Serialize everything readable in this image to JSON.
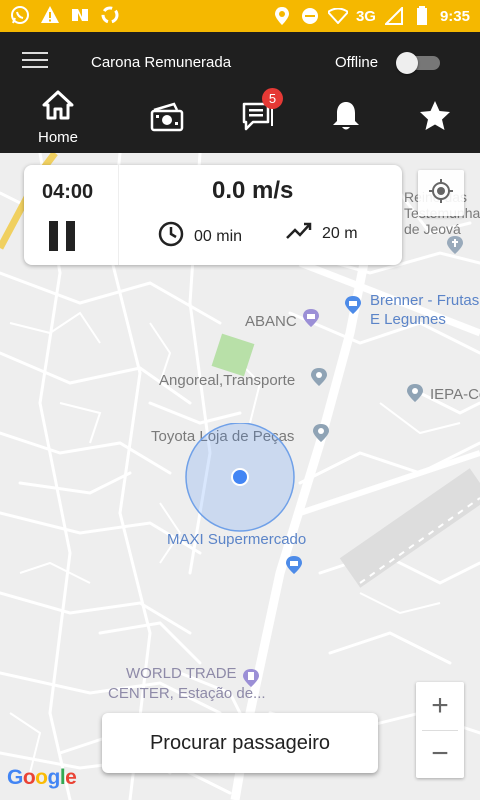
{
  "status_bar": {
    "network": "3G",
    "time": "9:35",
    "background": "#f5b800"
  },
  "app_bar": {
    "title": "Carona Remunerada",
    "status_label": "Offline",
    "toggle_on": false
  },
  "tabs": [
    {
      "icon": "home-icon",
      "label": "Home",
      "active": true
    },
    {
      "icon": "cash-icon",
      "label": ""
    },
    {
      "icon": "chat-icon",
      "label": "",
      "badge": "5"
    },
    {
      "icon": "bell-icon",
      "label": ""
    },
    {
      "icon": "star-icon",
      "label": ""
    }
  ],
  "ride_card": {
    "timer": "04:00",
    "speed": "0.0 m/s",
    "duration": "00 min",
    "distance": "20 m"
  },
  "map": {
    "labels": {
      "testemunhas": "Reino das\nTestemunhas\nde Jeová",
      "brenner": "Brenner - Frutas",
      "brenner2": "E Legumes",
      "abanc": "ABANC",
      "angoreal": "Angoreal,Transporte",
      "iepa": "IEPA-Co",
      "toyota": "Toyota Loja de Peças",
      "maxi": "MAXI Supermercado",
      "wtc1": "WORLD TRADE",
      "wtc2": "CENTER, Estação de..."
    },
    "accent": "#4285f4"
  },
  "controls": {
    "zoom_in": "+",
    "zoom_out": "−",
    "search_button": "Procurar passageiro",
    "logo": "Google"
  }
}
